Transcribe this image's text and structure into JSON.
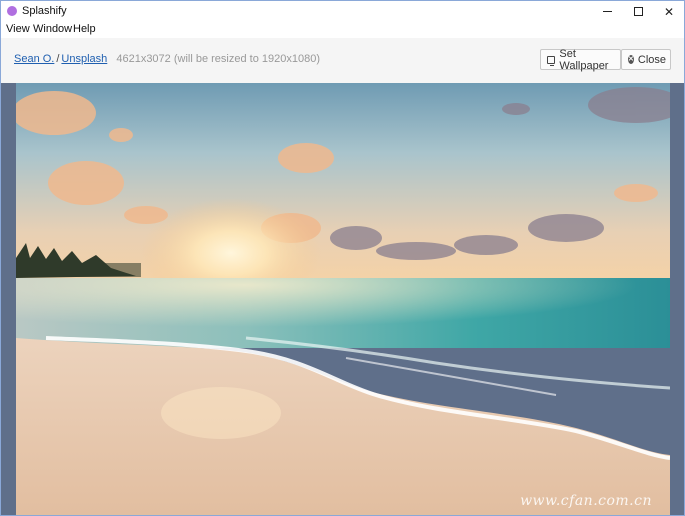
{
  "window": {
    "title": "Splashify"
  },
  "menu": {
    "items": [
      "View",
      "Window",
      "Help"
    ]
  },
  "toolbar": {
    "author": "Sean O.",
    "separator": "/",
    "source": "Unsplash",
    "dimensions": "4621x3072 (will be resized to 1920x1080)",
    "set_wallpaper_label": "Set Wallpaper",
    "close_label": "Close"
  },
  "watermark": "www.cfan.com.cn",
  "colors": {
    "accent": "#1f5fb0",
    "app_icon": "#b06fe0",
    "viewer_bg": "#5f6f8a"
  }
}
